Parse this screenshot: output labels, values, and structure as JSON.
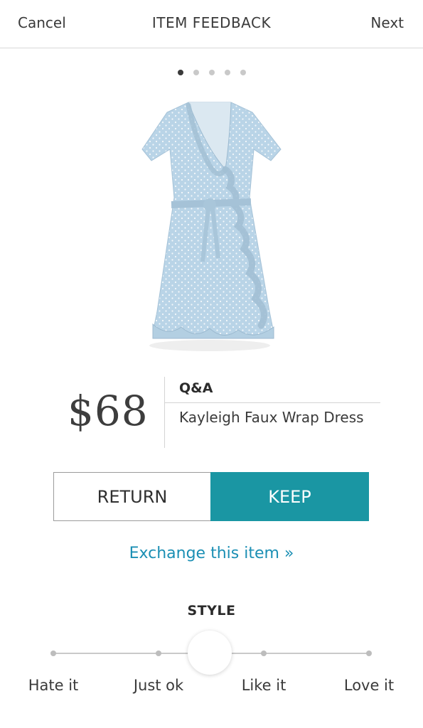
{
  "nav": {
    "cancel_label": "Cancel",
    "title": "ITEM FEEDBACK",
    "next_label": "Next"
  },
  "pager": {
    "total": 5,
    "active_index": 0
  },
  "product": {
    "image_icon": "polka-dot-wrap-dress-image",
    "price": "$68",
    "brand": "Q&A",
    "name": "Kayleigh Faux Wrap Dress"
  },
  "actions": {
    "return_label": "RETURN",
    "keep_label": "KEEP",
    "selected": "KEEP",
    "exchange_label": "Exchange this item »"
  },
  "style_rating": {
    "title": "STYLE",
    "options": [
      "Hate it",
      "Just ok",
      "Like it",
      "Love it"
    ],
    "selected_position": 0.5
  },
  "colors": {
    "accent": "#1a96a3",
    "link": "#1b8fb4",
    "dress": "#b7d3e6"
  }
}
